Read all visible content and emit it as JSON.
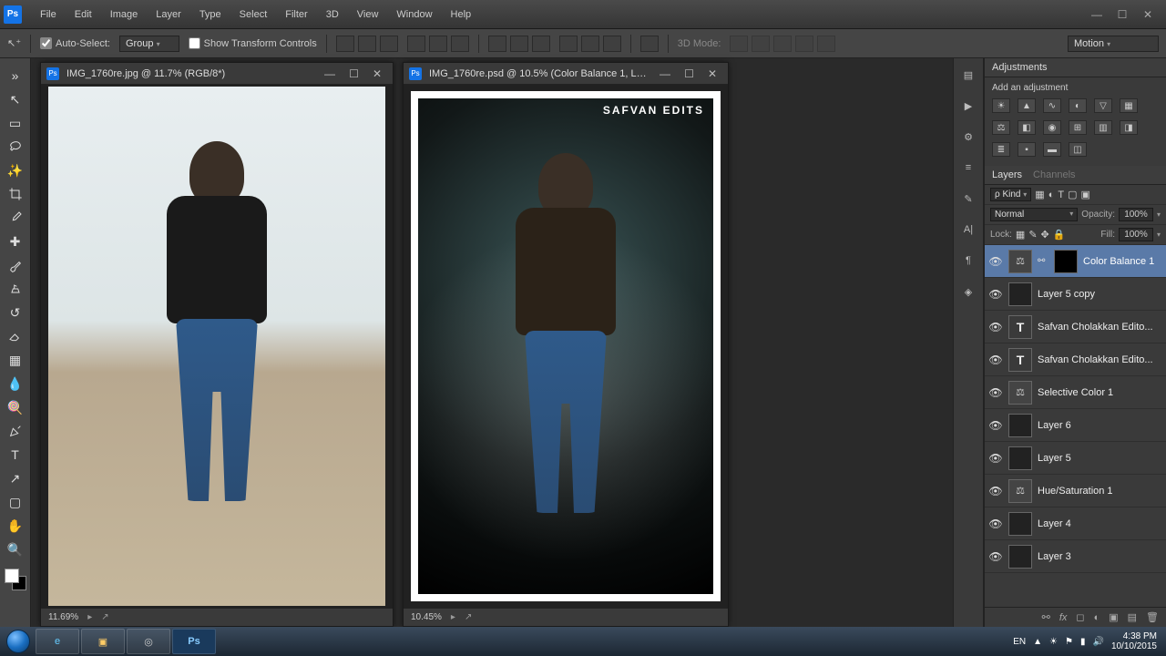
{
  "app": {
    "logo": "Ps"
  },
  "menu": [
    "File",
    "Edit",
    "Image",
    "Layer",
    "Type",
    "Select",
    "Filter",
    "3D",
    "View",
    "Window",
    "Help"
  ],
  "options": {
    "autoSelectLabel": "Auto-Select:",
    "autoSelectValue": "Group",
    "showTransformLabel": "Show Transform Controls",
    "threeDModeLabel": "3D Mode:",
    "workspacePreset": "Motion"
  },
  "documents": [
    {
      "title": "IMG_1760re.jpg @ 11.7% (RGB/8*)",
      "statusZoom": "11.69%"
    },
    {
      "title": "IMG_1760re.psd @ 10.5% (Color Balance 1, Layer...",
      "statusZoom": "10.45%",
      "watermark": "SAFVAN EDITS"
    }
  ],
  "adjustments": {
    "panelTitle": "Adjustments",
    "addLabel": "Add an adjustment"
  },
  "layersPanel": {
    "tabs": [
      "Layers",
      "Channels"
    ],
    "filterKind": "Kind",
    "blendMode": "Normal",
    "opacityLabel": "Opacity:",
    "opacityValue": "100%",
    "lockLabel": "Lock:",
    "fillLabel": "Fill:",
    "fillValue": "100%",
    "layers": [
      {
        "name": "Color Balance 1",
        "type": "adj",
        "selected": true,
        "mask": true
      },
      {
        "name": "Layer 5 copy",
        "type": "raster"
      },
      {
        "name": "Safvan Cholakkan Edito...",
        "type": "text"
      },
      {
        "name": "Safvan Cholakkan Edito...",
        "type": "text"
      },
      {
        "name": "Selective Color 1",
        "type": "adj"
      },
      {
        "name": "Layer 6",
        "type": "raster"
      },
      {
        "name": "Layer 5",
        "type": "raster"
      },
      {
        "name": "Hue/Saturation 1",
        "type": "adj"
      },
      {
        "name": "Layer 4",
        "type": "raster"
      },
      {
        "name": "Layer 3",
        "type": "raster"
      }
    ]
  },
  "taskbar": {
    "lang": "EN",
    "time": "4:38 PM",
    "date": "10/10/2015"
  }
}
